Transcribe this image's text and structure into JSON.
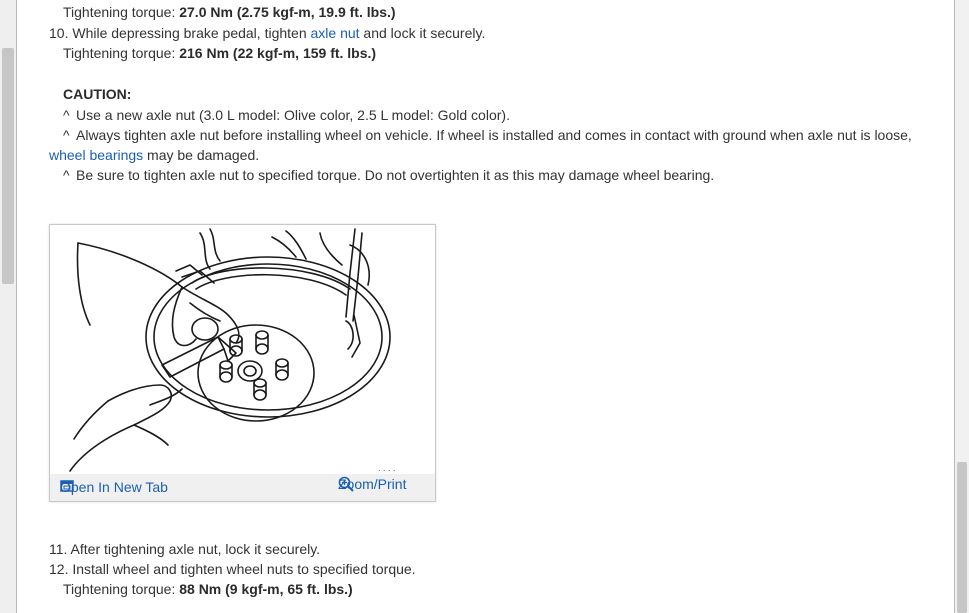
{
  "doc": {
    "torque_prev_prefix": "Tightening torque: ",
    "torque_prev_value": "27.0 Nm (2.75 kgf-m, 19.9 ft. lbs.)",
    "step10_prefix": "10. While depressing brake pedal, tighten ",
    "step10_link": "axle nut",
    "step10_suffix": " and lock it securely.",
    "torque10_prefix": "Tightening torque: ",
    "torque10_value": "216 Nm (22 kgf-m, 159 ft. lbs.)",
    "caution_title": "CAUTION:",
    "bullet_char": "^",
    "caution1": "Use a new axle nut (3.0 L model: Olive color, 2.5 L model: Gold color).",
    "caution2_line1": "Always tighten axle nut before installing wheel on vehicle. If wheel is installed and comes in contact with ground when axle nut is loose,",
    "caution2_link": "wheel bearings",
    "caution2_line2_suffix": " may be damaged.",
    "caution3": "Be sure to tighten axle nut to specified torque. Do not overtighten it as this may damage wheel bearing.",
    "step11": "11. After tightening axle nut, lock it securely.",
    "step12": "12. Install wheel and tighten wheel nuts to specified torque.",
    "torque12_prefix": "Tightening torque: ",
    "torque12_value": "88 Nm (9 kgf-m, 65 ft. lbs.)"
  },
  "figure": {
    "open_tab_label": "Open In New Tab",
    "zoom_label": "Zoom/Print",
    "open_tab_icon": "open-in-new-tab-icon",
    "zoom_icon": "magnifier-zoom-icon"
  }
}
